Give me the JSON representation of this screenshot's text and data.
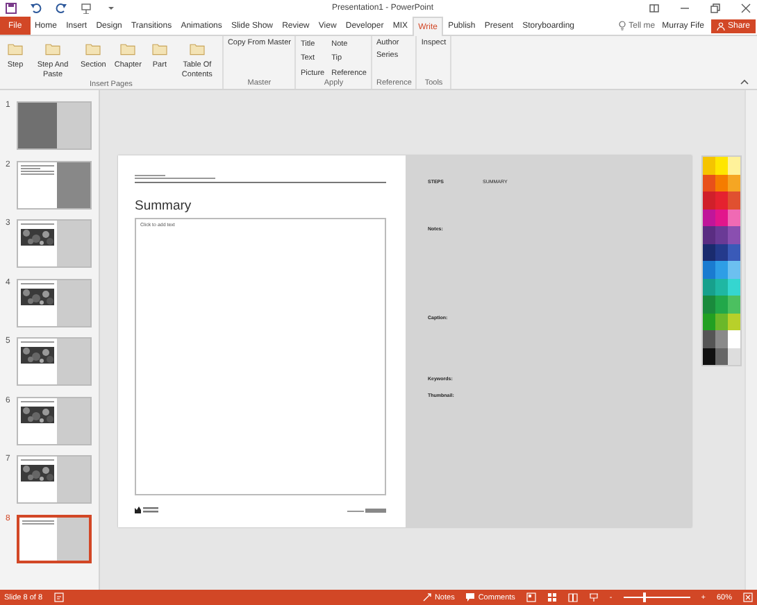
{
  "window": {
    "title": "Presentation1 - PowerPoint"
  },
  "tabs": [
    {
      "label": "File",
      "kind": "file",
      "selected": false
    },
    {
      "label": "Home",
      "kind": "tab",
      "selected": false
    },
    {
      "label": "Insert",
      "kind": "tab",
      "selected": false
    },
    {
      "label": "Design",
      "kind": "tab",
      "selected": false
    },
    {
      "label": "Transitions",
      "kind": "tab",
      "selected": false
    },
    {
      "label": "Animations",
      "kind": "tab",
      "selected": false
    },
    {
      "label": "Slide Show",
      "kind": "tab",
      "selected": false
    },
    {
      "label": "Review",
      "kind": "tab",
      "selected": false
    },
    {
      "label": "View",
      "kind": "tab",
      "selected": false
    },
    {
      "label": "Developer",
      "kind": "tab",
      "selected": false
    },
    {
      "label": "MIX",
      "kind": "tab",
      "selected": false
    },
    {
      "label": "Write",
      "kind": "tab",
      "selected": true
    },
    {
      "label": "Publish",
      "kind": "tab",
      "selected": false
    },
    {
      "label": "Present",
      "kind": "tab",
      "selected": false
    },
    {
      "label": "Storyboarding",
      "kind": "tab",
      "selected": false
    }
  ],
  "tell_me": "Tell me",
  "user": "Murray Fife",
  "share_button": "Share",
  "ribbon": [
    {
      "label": "Insert Pages",
      "kind": "large",
      "items": [
        "Step",
        "Step And Paste",
        "Section",
        "Chapter",
        "Part",
        "Table Of Contents"
      ]
    },
    {
      "label": "Master",
      "kind": "list",
      "items": [
        "Copy From Master"
      ]
    },
    {
      "label": "Apply",
      "kind": "grid",
      "items": [
        "Title",
        "Note",
        "Text",
        "Tip",
        "Picture",
        "Reference"
      ]
    },
    {
      "label": "Reference",
      "kind": "list",
      "items": [
        "Author",
        "Series"
      ]
    },
    {
      "label": "Tools",
      "kind": "list",
      "items": [
        "Inspect"
      ]
    }
  ],
  "slides": [
    {
      "number": "1",
      "kind": "cover",
      "selected": false
    },
    {
      "number": "2",
      "kind": "text",
      "selected": false
    },
    {
      "number": "3",
      "kind": "picture",
      "selected": false
    },
    {
      "number": "4",
      "kind": "picture",
      "selected": false
    },
    {
      "number": "5",
      "kind": "picture",
      "selected": false
    },
    {
      "number": "6",
      "kind": "picture",
      "selected": false
    },
    {
      "number": "7",
      "kind": "picture",
      "selected": false
    },
    {
      "number": "8",
      "kind": "blank",
      "selected": true
    }
  ],
  "slide": {
    "title": "Summary",
    "placeholder": "Click to add text",
    "steps_label": "STEPS",
    "steps_value": "SUMMARY",
    "fields": [
      "Notes:",
      "Caption:",
      "Keywords:",
      "Thumbnail:"
    ]
  },
  "palette": [
    {
      "color": "#f5c400"
    },
    {
      "color": "#ffe600"
    },
    {
      "color": "#fff29a"
    },
    {
      "color": "#e8501a"
    },
    {
      "color": "#f57c00"
    },
    {
      "color": "#f5a623"
    },
    {
      "color": "#d0202a"
    },
    {
      "color": "#e5222f"
    },
    {
      "color": "#e05030"
    },
    {
      "color": "#c0169a"
    },
    {
      "color": "#e2168c"
    },
    {
      "color": "#f06ab4"
    },
    {
      "color": "#5a2d82"
    },
    {
      "color": "#6a3a96"
    },
    {
      "color": "#8a4fb0"
    },
    {
      "color": "#1a2b6e"
    },
    {
      "color": "#243a8c"
    },
    {
      "color": "#3a5ab8"
    },
    {
      "color": "#1a7bd0"
    },
    {
      "color": "#2e9ee6"
    },
    {
      "color": "#6cc0f0"
    },
    {
      "color": "#17a08c"
    },
    {
      "color": "#1fb7a3"
    },
    {
      "color": "#35d6d0"
    },
    {
      "color": "#1a8a3c"
    },
    {
      "color": "#22a84a"
    },
    {
      "color": "#4cc060"
    },
    {
      "color": "#22a022"
    },
    {
      "color": "#6ab82a"
    },
    {
      "color": "#b8d02a"
    },
    {
      "color": "#555555"
    },
    {
      "color": "#8a8a8a"
    },
    {
      "color": "#ffffff"
    },
    {
      "color": "#111111"
    },
    {
      "color": "#666666"
    },
    {
      "color": "#dddddd"
    }
  ],
  "status_bar": {
    "slide_info": "Slide 8 of 8",
    "notes": "Notes",
    "comments": "Comments",
    "zoom": "60%",
    "zoom_out": "-",
    "zoom_in": "+",
    "zoom_slider": {
      "level": 0.31
    }
  }
}
